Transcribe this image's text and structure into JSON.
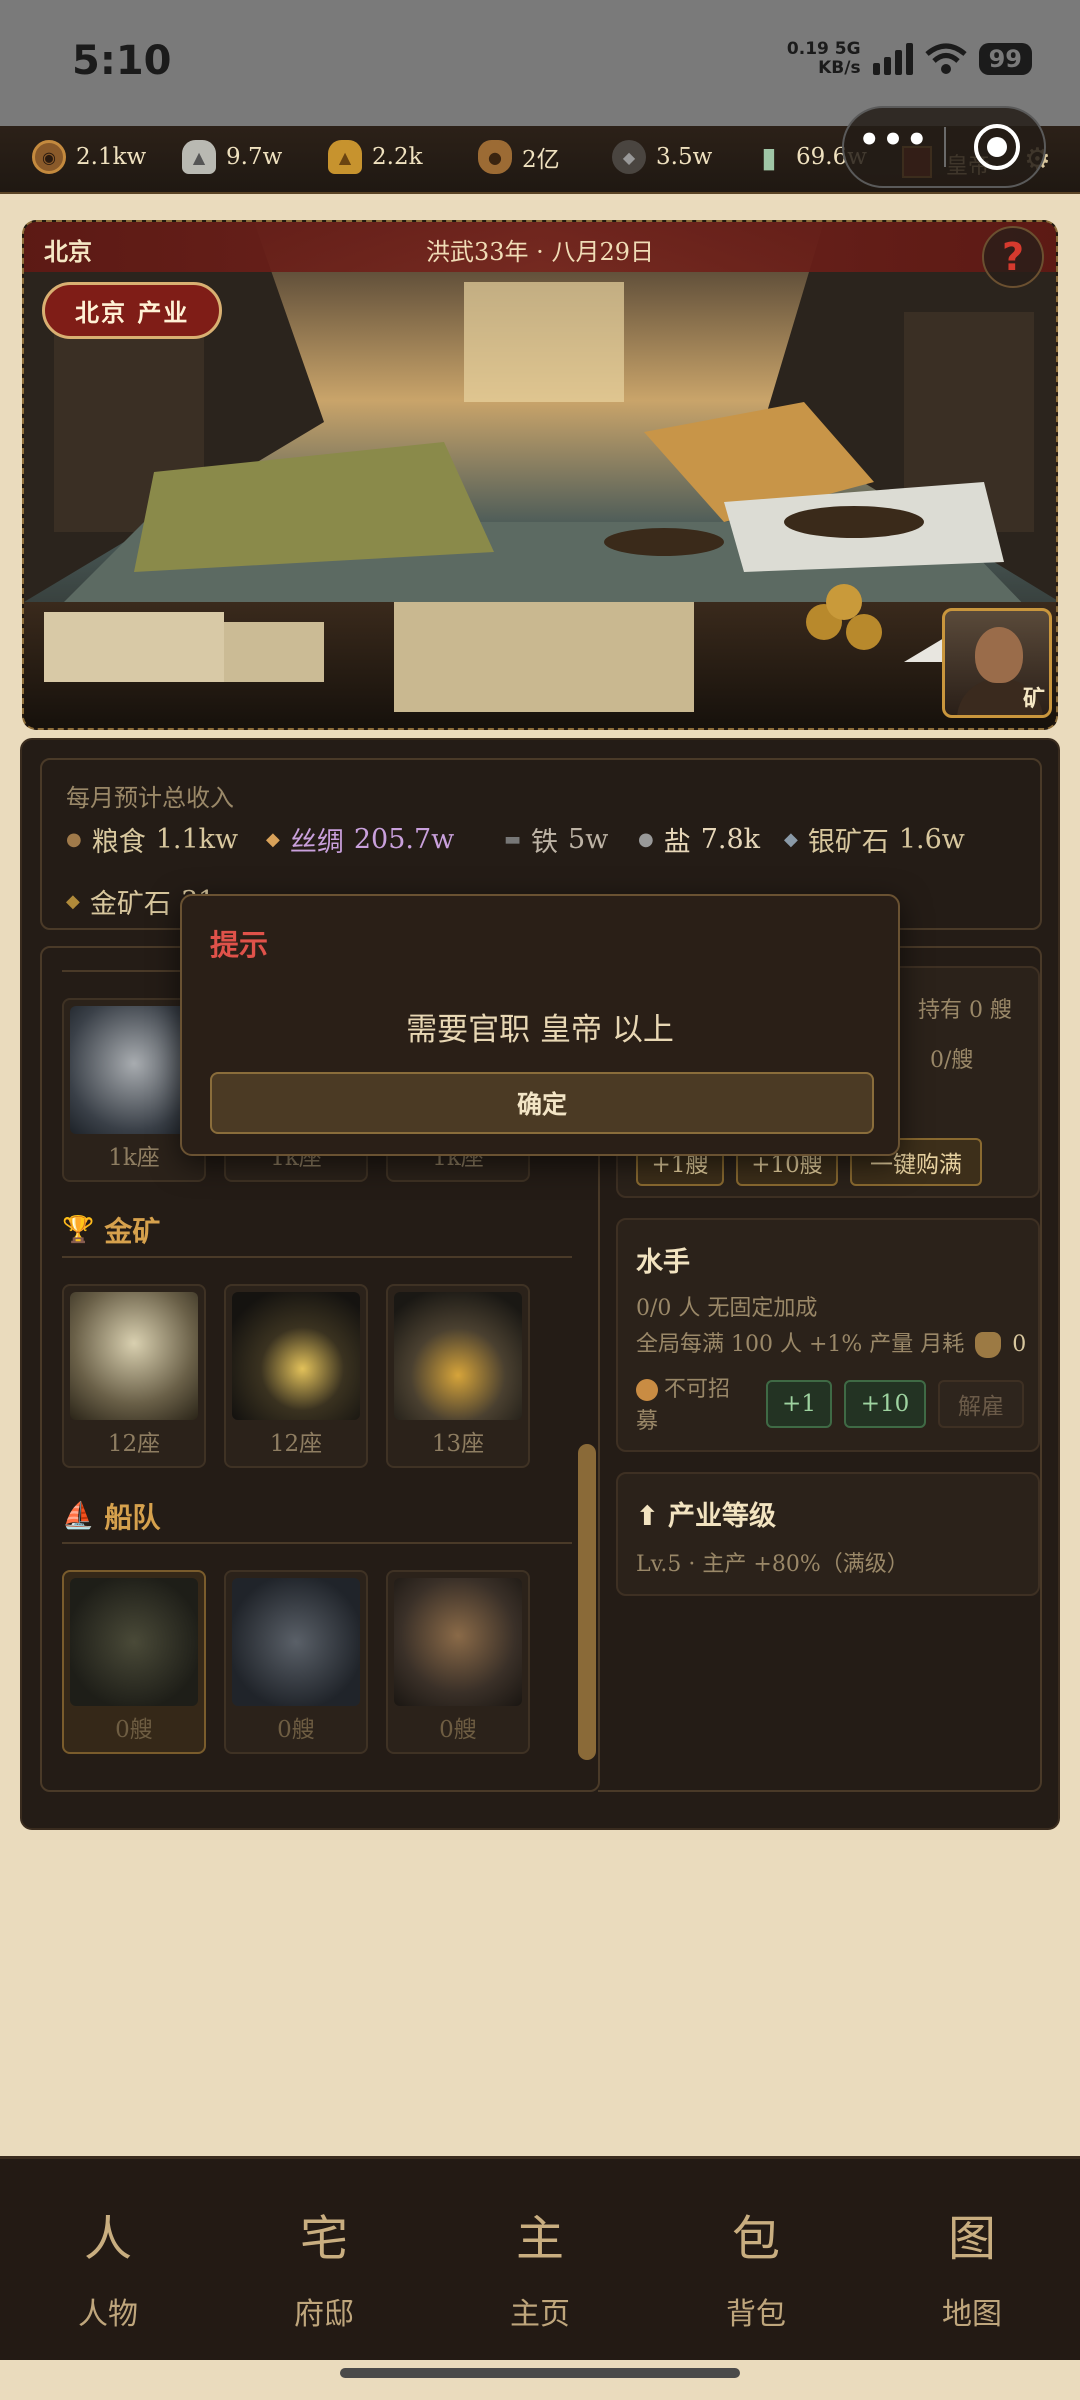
{
  "status_bar": {
    "time": "5:10",
    "net_speed": "0.19",
    "net_unit": "KB/s",
    "net_type": "5G",
    "battery": "99"
  },
  "resources": [
    {
      "icon": "coin-icon",
      "value": "2.1kw"
    },
    {
      "icon": "silver-ingot-icon",
      "value": "9.7w"
    },
    {
      "icon": "gold-ingot-icon",
      "value": "2.2k"
    },
    {
      "icon": "money-bag-icon",
      "value": "2亿"
    },
    {
      "icon": "ore-icon",
      "value": "3.5w"
    },
    {
      "icon": "jade-icon",
      "value": "69.6w"
    }
  ],
  "capsule": {
    "more": "•••"
  },
  "top_right": {
    "emperor": "皇帝"
  },
  "hero": {
    "city": "北京",
    "date": "洪武33年 · 八月29日",
    "help": "?",
    "industry_pill": "北京 产业",
    "portrait_tag": "矿"
  },
  "income": {
    "title": "每月预计总收入",
    "items": [
      {
        "icon": "grain-icon",
        "label": "粮食",
        "value": "1.1kw",
        "color": "#d8c79e"
      },
      {
        "icon": "silk-icon",
        "label": "丝绸",
        "value": "205.7w",
        "color": "#c9a0dc"
      },
      {
        "icon": "iron-icon",
        "label": "铁",
        "value": "5w",
        "color": "#bdb3a5"
      },
      {
        "icon": "salt-icon",
        "label": "盐",
        "value": "7.8k",
        "color": "#e6d6b8"
      },
      {
        "icon": "silver-ore-icon",
        "label": "银矿石",
        "value": "1.6w",
        "color": "#d8c79e"
      },
      {
        "icon": "gold-ore-icon",
        "label": "金矿石",
        "value": "31",
        "color": "#d8c79e"
      }
    ]
  },
  "left_list": {
    "row1_counts": [
      "1k座",
      "1k座",
      "1k座"
    ],
    "gold_section": {
      "title": "金矿",
      "counts": [
        "12座",
        "12座",
        "13座"
      ]
    },
    "fleet_section": {
      "title": "船队",
      "counts": [
        "0艘",
        "0艘",
        "0艘"
      ]
    }
  },
  "ships_card": {
    "owned": "持有 0 艘",
    "price": "0/艘",
    "btn_plus1": "+1艘",
    "btn_plus10": "+10艘",
    "btn_fill": "一键购满"
  },
  "sailors_card": {
    "title": "水手",
    "line1": "0/0 人  无固定加成",
    "line2": "全局每满 100 人 +1% 产量  月耗",
    "monthly_cost": "0",
    "status": "不可招募",
    "btn_plus1": "+1",
    "btn_plus10": "+10",
    "btn_fire": "解雇"
  },
  "level_card": {
    "title": "产业等级",
    "line": "Lv.5 · 主产 +80%（满级）"
  },
  "modal": {
    "title": "提示",
    "message": "需要官职 皇帝 以上",
    "ok": "确定"
  },
  "bottom_nav": [
    {
      "glyph": "人",
      "label": "人物"
    },
    {
      "glyph": "宅",
      "label": "府邸"
    },
    {
      "glyph": "主",
      "label": "主页"
    },
    {
      "glyph": "包",
      "label": "背包"
    },
    {
      "glyph": "图",
      "label": "地图"
    }
  ]
}
